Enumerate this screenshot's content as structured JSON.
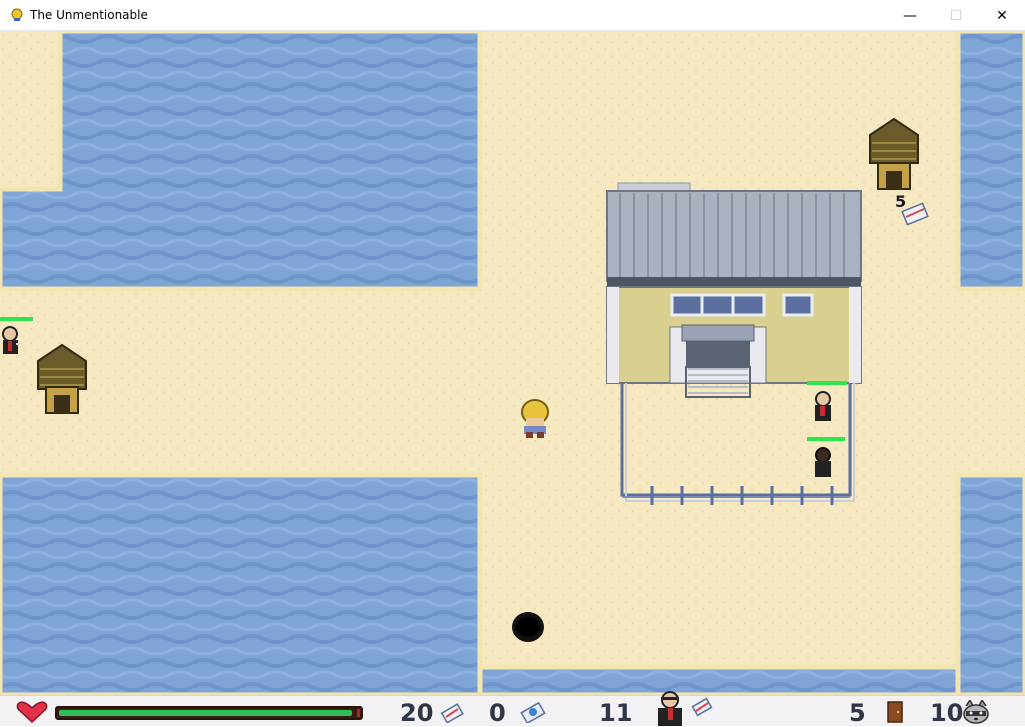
{
  "window": {
    "title": "The Unmentionable",
    "minimize_symbol": "—",
    "maximize_symbol": "☐",
    "close_symbol": "✕"
  },
  "map": {
    "terrain_colors": {
      "sand": "#f6e9c2",
      "water": "#7fa4d6",
      "water_wave": "#6d94cb"
    },
    "objects": [
      {
        "name": "building",
        "type": "warehouse"
      },
      {
        "name": "hut",
        "count": 2
      },
      {
        "name": "player"
      },
      {
        "name": "enemy",
        "count": 3
      },
      {
        "name": "hole"
      }
    ],
    "pickup_label": "5"
  },
  "hud": {
    "health_fraction": 0.99,
    "items": [
      {
        "icon": "heart-icon",
        "value": ""
      },
      {
        "icon": "tissue-box-icon",
        "value": "20"
      },
      {
        "icon": "pill-box-icon",
        "value": "0"
      },
      {
        "icon": "enemy-with-tissue-icon",
        "value": "11"
      },
      {
        "icon": "door-icon",
        "value": "5"
      },
      {
        "icon": "raccoon-icon",
        "value": "10"
      }
    ]
  }
}
